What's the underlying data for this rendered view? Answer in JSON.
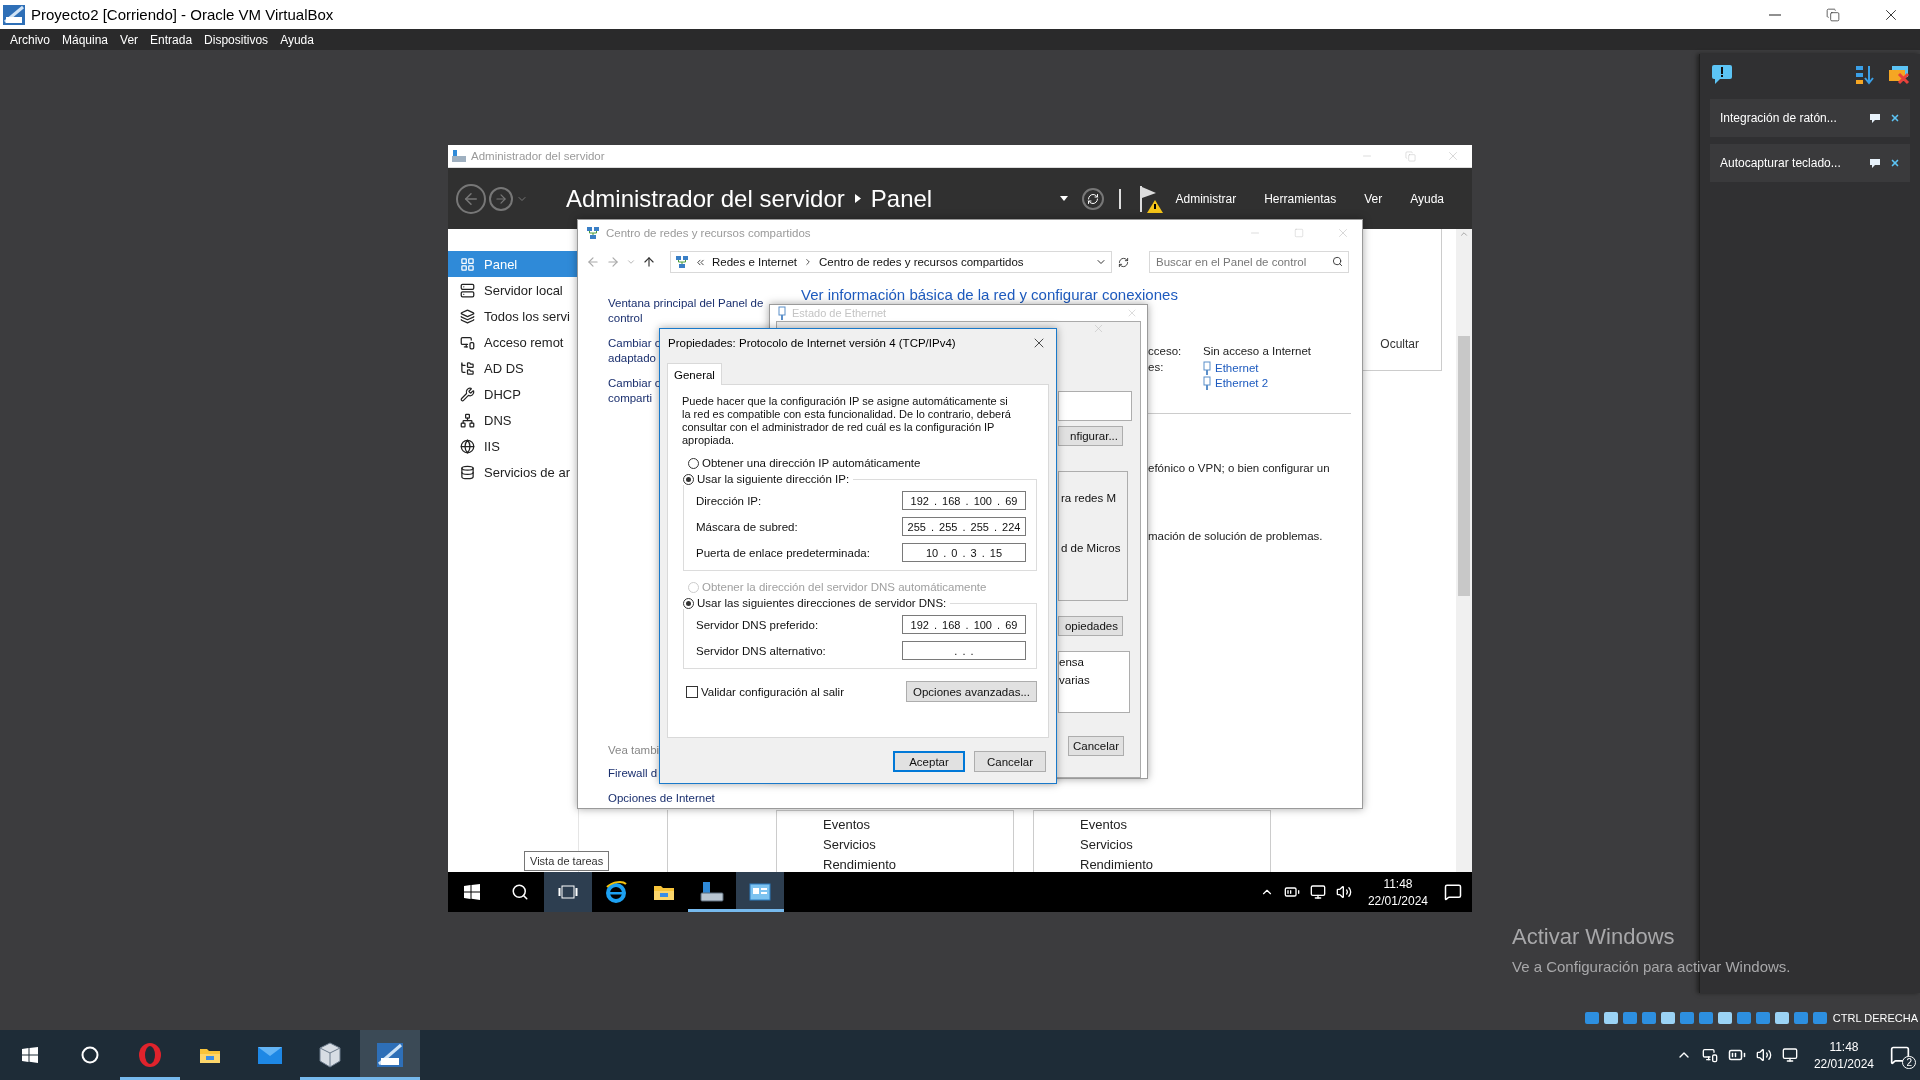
{
  "vbox": {
    "title": "Proyecto2 [Corriendo] - Oracle VM VirtualBox",
    "menu": [
      "Archivo",
      "Máquina",
      "Ver",
      "Entrada",
      "Dispositivos",
      "Ayuda"
    ]
  },
  "server_manager": {
    "title": "Administrador del servidor",
    "breadcrumb": [
      "Administrador del servidor",
      "Panel"
    ],
    "menu": [
      "Administrar",
      "Herramientas",
      "Ver",
      "Ayuda"
    ],
    "sidebar": [
      {
        "label": "Panel",
        "selected": true
      },
      {
        "label": "Servidor local",
        "selected": false
      },
      {
        "label": "Todos los servi",
        "selected": false
      },
      {
        "label": "Acceso remot",
        "selected": false
      },
      {
        "label": "AD DS",
        "selected": false
      },
      {
        "label": "DHCP",
        "selected": false
      },
      {
        "label": "DNS",
        "selected": false
      },
      {
        "label": "IIS",
        "selected": false
      },
      {
        "label": "Servicios de ar",
        "selected": false
      }
    ],
    "hide_link": "Ocultar",
    "tiles": [
      {
        "items": [
          "Eventos",
          "Servicios",
          "Rendimiento"
        ]
      },
      {
        "items": [
          "Eventos",
          "Servicios",
          "Rendimiento"
        ]
      }
    ],
    "tooltip": "Vista de tareas"
  },
  "network_center": {
    "title": "Centro de redes y recursos compartidos",
    "address": [
      "Redes e Internet",
      "Centro de redes y recursos compartidos"
    ],
    "search": {
      "placeholder": "Buscar en el Panel de control"
    },
    "tasks": [
      "Ventana principal del Panel de\ncontrol",
      "Cambiar c\nadaptado",
      "Cambiar c\ncomparti"
    ],
    "see_also_title": "Vea tambi",
    "see_also": [
      "Firewall d",
      "Opciones de Internet"
    ],
    "heading": "Ver información básica de la red y configurar conexiones",
    "access_label": "cceso:",
    "access_value": "Sin acceso a Internet",
    "connections_label": "es:",
    "connections": [
      "Ethernet",
      "Ethernet 2"
    ],
    "text_1": "efónico o VPN; o bien configurar un",
    "text_2": "mación de solución de problemas."
  },
  "ethernet": {
    "title": "Estado de Ethernet",
    "configure_button": "nfigurar...",
    "components": [
      "ra redes M",
      "d de Micros"
    ],
    "properties_button": "opiedades",
    "description": "ensa\nvarias",
    "cancel_button": "Cancelar"
  },
  "tcp_dialog": {
    "title": "Propiedades: Protocolo de Internet versión 4 (TCP/IPv4)",
    "tabs": [
      {
        "label": "General",
        "selected": true
      }
    ],
    "description": "Puede hacer que la configuración IP se asigne automáticamente si la red es compatible con esta funcionalidad. De lo contrario, deberá consultar con el administrador de red cuál es la configuración IP apropiada.",
    "ip_auto": {
      "label": "Obtener una dirección IP automáticamente",
      "selected": false,
      "disabled": false
    },
    "ip_manual": {
      "label": "Usar la siguiente dirección IP:",
      "selected": true,
      "disabled": false
    },
    "ip_fields": [
      {
        "label": "Dirección IP:",
        "value": "192 . 168 . 100 . 69"
      },
      {
        "label": "Máscara de subred:",
        "value": "255 . 255 . 255 . 224"
      },
      {
        "label": "Puerta de enlace predeterminada:",
        "value": "10 . 0 . 3 . 15"
      }
    ],
    "dns_auto": {
      "label": "Obtener la dirección del servidor DNS automáticamente",
      "selected": false,
      "disabled": true
    },
    "dns_manual": {
      "label": "Usar las siguientes direcciones de servidor DNS:",
      "selected": true,
      "disabled": false
    },
    "dns_fields": [
      {
        "label": "Servidor DNS preferido:",
        "value": "192 . 168 . 100 . 69"
      },
      {
        "label": "Servidor DNS alternativo:",
        "value": ". . ."
      }
    ],
    "validate": {
      "label": "Validar configuración al salir",
      "checked": false
    },
    "advanced_button": "Opciones avanzadas...",
    "buttons": [
      {
        "label": "Aceptar",
        "default": true
      },
      {
        "label": "Cancelar",
        "default": false
      }
    ]
  },
  "guest_taskbar": {
    "apps": [
      {
        "kind": "start",
        "running": false,
        "selected": false
      },
      {
        "kind": "search",
        "running": false,
        "selected": false
      },
      {
        "kind": "task_view",
        "running": false,
        "selected": true
      },
      {
        "kind": "ie",
        "running": false,
        "selected": false
      },
      {
        "kind": "explorer",
        "running": false,
        "selected": false
      },
      {
        "kind": "server_manager",
        "running": true,
        "selected": false
      },
      {
        "kind": "network",
        "running": true,
        "selected": true
      }
    ],
    "time": "11:48",
    "date": "22/01/2024"
  },
  "side_panel": {
    "notifications": [
      "Integración de ratón...",
      "Autocapturar teclado..."
    ]
  },
  "activation": {
    "title": "Activar Windows",
    "text": "Ve a Configuración para activar Windows."
  },
  "status_key": "CTRL DERECHA",
  "host_taskbar": {
    "apps": [
      {
        "kind": "start",
        "running": false,
        "selected": false
      },
      {
        "kind": "cortana",
        "running": false,
        "selected": false
      },
      {
        "kind": "opera",
        "running": true,
        "selected": false
      },
      {
        "kind": "explorer",
        "running": false,
        "selected": false
      },
      {
        "kind": "mail",
        "running": false,
        "selected": false
      },
      {
        "kind": "virtualbox",
        "running": true,
        "selected": false
      },
      {
        "kind": "vm",
        "running": true,
        "selected": true
      }
    ],
    "time": "11:48",
    "date": "22/01/2024",
    "notification_count": "2"
  }
}
